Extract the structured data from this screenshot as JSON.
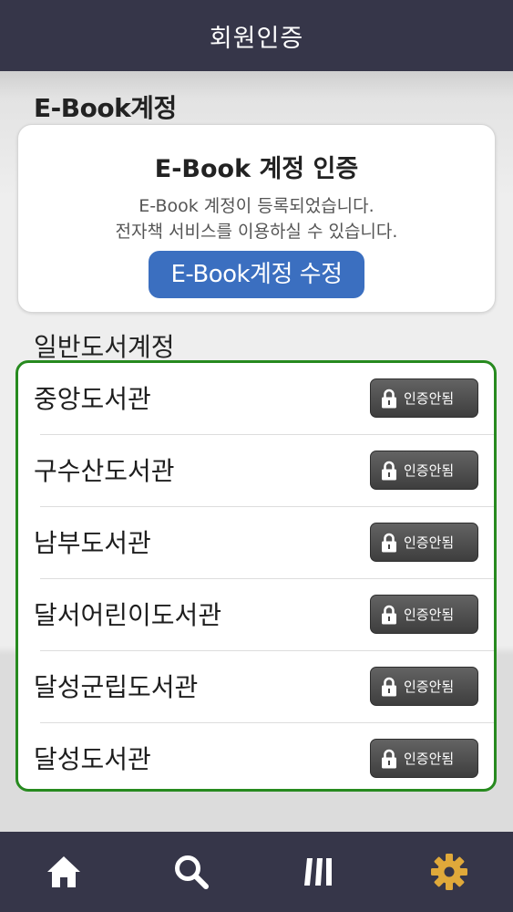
{
  "header": {
    "title": "회원인증"
  },
  "ebook_section": {
    "title": "E-Book계정",
    "card": {
      "heading": "E-Book 계정 인증",
      "desc_line1": "E-Book 계정이 등록되었습니다.",
      "desc_line2": "전자책 서비스를 이용하실 수 있습니다.",
      "edit_button_label": "E-Book계정 수정"
    }
  },
  "general_section": {
    "title": "일반도서계정",
    "libraries": [
      {
        "name": "중앙도서관",
        "status": "인증안됨"
      },
      {
        "name": "구수산도서관",
        "status": "인증안됨"
      },
      {
        "name": "남부도서관",
        "status": "인증안됨"
      },
      {
        "name": "달서어린이도서관",
        "status": "인증안됨"
      },
      {
        "name": "달성군립도서관",
        "status": "인증안됨"
      },
      {
        "name": "달성도서관",
        "status": "인증안됨"
      }
    ]
  },
  "bottom_nav": {
    "items": [
      {
        "icon": "home-icon",
        "active": false
      },
      {
        "icon": "search-icon",
        "active": false
      },
      {
        "icon": "library-shelf-icon",
        "active": false
      },
      {
        "icon": "gear-icon",
        "active": true
      }
    ]
  },
  "colors": {
    "header_bg": "#363649",
    "list_border": "#278a1f",
    "edit_button": "#3b6fc0",
    "badge_bg": "#4a4a4a",
    "active_tab": "#e0a93a",
    "inactive_tab": "#ffffff"
  }
}
